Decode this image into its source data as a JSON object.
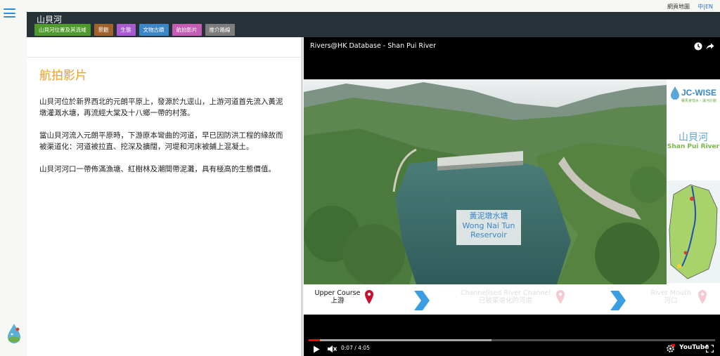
{
  "top_links": {
    "sitemap": "網頁地圖",
    "lang_zh": "中",
    "lang_sep": "|",
    "lang_en": "EN"
  },
  "header": {
    "title": "山貝河",
    "tabs": [
      {
        "label": "山貝河位置及其流域",
        "color": "#4f9a2b"
      },
      {
        "label": "景觀",
        "color": "#a1622b"
      },
      {
        "label": "生態",
        "color": "#a95ad1"
      },
      {
        "label": "文物古蹟",
        "color": "#3b86c6"
      },
      {
        "label": "航拍影片",
        "color": "#c55bb3"
      },
      {
        "label": "推介路線",
        "color": "#7d7d7d"
      }
    ]
  },
  "content": {
    "heading": "航拍影片",
    "paragraphs": [
      "山貝河位於新界西北的元朗平原上，發源於九逕山，上游河道首先流入黃泥墩灌溉水塘，再流經大棠及十八鄉一帶的村落。",
      "當山貝河流入元朗平原時，下游原本彎曲的河道，早已因防洪工程的緣故而被渠道化：河道被拉直、挖深及擴闊，河堤和河床被鋪上混凝土。",
      "山貝河河口一帶佈滿漁塘、紅樹林及潮間帶泥灘，具有極高的生態價值。"
    ]
  },
  "video": {
    "title": "Rivers@HK Database - Shan Pui River",
    "logo_text": "JC-WISE",
    "logo_sub": "賽馬會惜水‧識河計劃",
    "river_name_zh": "山貝河",
    "river_name_en": "Shan Pui River",
    "caption_zh": "黃泥墩水塘",
    "caption_en_line1": "Wong Nai Tun",
    "caption_en_line2": "Reservoir",
    "course": [
      {
        "en": "Upper Course",
        "zh": "上游",
        "active": true
      },
      {
        "en": "Channelised River Channel",
        "zh": "已被渠道化的河道",
        "active": false
      },
      {
        "en": "River Mouth",
        "zh": "河口",
        "active": false
      }
    ],
    "time_display": "0:07 / 4:05",
    "brand": "YouTube",
    "played_fraction": 0.028,
    "buffered_fraction": 0.45,
    "accent_color": "#ff0000"
  }
}
